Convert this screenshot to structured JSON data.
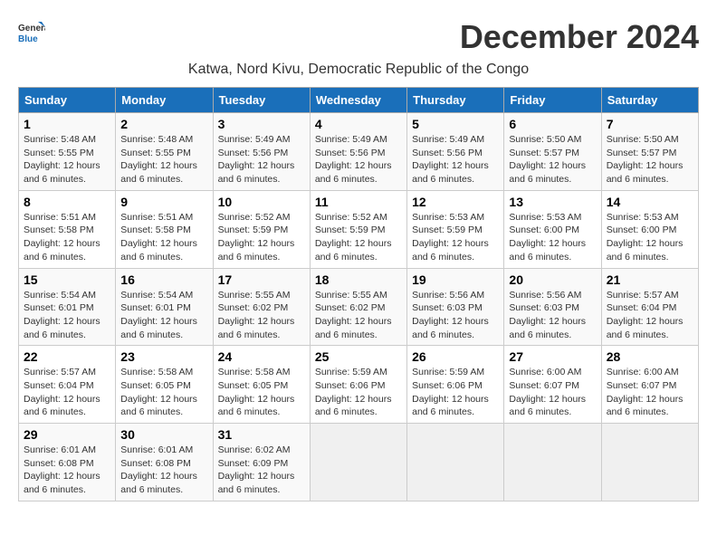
{
  "logo": {
    "line1": "General",
    "line2": "Blue"
  },
  "title": "December 2024",
  "location": "Katwa, Nord Kivu, Democratic Republic of the Congo",
  "days_of_week": [
    "Sunday",
    "Monday",
    "Tuesday",
    "Wednesday",
    "Thursday",
    "Friday",
    "Saturday"
  ],
  "weeks": [
    [
      {
        "day": "1",
        "sunrise": "Sunrise: 5:48 AM",
        "sunset": "Sunset: 5:55 PM",
        "daylight": "Daylight: 12 hours and 6 minutes."
      },
      {
        "day": "2",
        "sunrise": "Sunrise: 5:48 AM",
        "sunset": "Sunset: 5:55 PM",
        "daylight": "Daylight: 12 hours and 6 minutes."
      },
      {
        "day": "3",
        "sunrise": "Sunrise: 5:49 AM",
        "sunset": "Sunset: 5:56 PM",
        "daylight": "Daylight: 12 hours and 6 minutes."
      },
      {
        "day": "4",
        "sunrise": "Sunrise: 5:49 AM",
        "sunset": "Sunset: 5:56 PM",
        "daylight": "Daylight: 12 hours and 6 minutes."
      },
      {
        "day": "5",
        "sunrise": "Sunrise: 5:49 AM",
        "sunset": "Sunset: 5:56 PM",
        "daylight": "Daylight: 12 hours and 6 minutes."
      },
      {
        "day": "6",
        "sunrise": "Sunrise: 5:50 AM",
        "sunset": "Sunset: 5:57 PM",
        "daylight": "Daylight: 12 hours and 6 minutes."
      },
      {
        "day": "7",
        "sunrise": "Sunrise: 5:50 AM",
        "sunset": "Sunset: 5:57 PM",
        "daylight": "Daylight: 12 hours and 6 minutes."
      }
    ],
    [
      {
        "day": "8",
        "sunrise": "Sunrise: 5:51 AM",
        "sunset": "Sunset: 5:58 PM",
        "daylight": "Daylight: 12 hours and 6 minutes."
      },
      {
        "day": "9",
        "sunrise": "Sunrise: 5:51 AM",
        "sunset": "Sunset: 5:58 PM",
        "daylight": "Daylight: 12 hours and 6 minutes."
      },
      {
        "day": "10",
        "sunrise": "Sunrise: 5:52 AM",
        "sunset": "Sunset: 5:59 PM",
        "daylight": "Daylight: 12 hours and 6 minutes."
      },
      {
        "day": "11",
        "sunrise": "Sunrise: 5:52 AM",
        "sunset": "Sunset: 5:59 PM",
        "daylight": "Daylight: 12 hours and 6 minutes."
      },
      {
        "day": "12",
        "sunrise": "Sunrise: 5:53 AM",
        "sunset": "Sunset: 5:59 PM",
        "daylight": "Daylight: 12 hours and 6 minutes."
      },
      {
        "day": "13",
        "sunrise": "Sunrise: 5:53 AM",
        "sunset": "Sunset: 6:00 PM",
        "daylight": "Daylight: 12 hours and 6 minutes."
      },
      {
        "day": "14",
        "sunrise": "Sunrise: 5:53 AM",
        "sunset": "Sunset: 6:00 PM",
        "daylight": "Daylight: 12 hours and 6 minutes."
      }
    ],
    [
      {
        "day": "15",
        "sunrise": "Sunrise: 5:54 AM",
        "sunset": "Sunset: 6:01 PM",
        "daylight": "Daylight: 12 hours and 6 minutes."
      },
      {
        "day": "16",
        "sunrise": "Sunrise: 5:54 AM",
        "sunset": "Sunset: 6:01 PM",
        "daylight": "Daylight: 12 hours and 6 minutes."
      },
      {
        "day": "17",
        "sunrise": "Sunrise: 5:55 AM",
        "sunset": "Sunset: 6:02 PM",
        "daylight": "Daylight: 12 hours and 6 minutes."
      },
      {
        "day": "18",
        "sunrise": "Sunrise: 5:55 AM",
        "sunset": "Sunset: 6:02 PM",
        "daylight": "Daylight: 12 hours and 6 minutes."
      },
      {
        "day": "19",
        "sunrise": "Sunrise: 5:56 AM",
        "sunset": "Sunset: 6:03 PM",
        "daylight": "Daylight: 12 hours and 6 minutes."
      },
      {
        "day": "20",
        "sunrise": "Sunrise: 5:56 AM",
        "sunset": "Sunset: 6:03 PM",
        "daylight": "Daylight: 12 hours and 6 minutes."
      },
      {
        "day": "21",
        "sunrise": "Sunrise: 5:57 AM",
        "sunset": "Sunset: 6:04 PM",
        "daylight": "Daylight: 12 hours and 6 minutes."
      }
    ],
    [
      {
        "day": "22",
        "sunrise": "Sunrise: 5:57 AM",
        "sunset": "Sunset: 6:04 PM",
        "daylight": "Daylight: 12 hours and 6 minutes."
      },
      {
        "day": "23",
        "sunrise": "Sunrise: 5:58 AM",
        "sunset": "Sunset: 6:05 PM",
        "daylight": "Daylight: 12 hours and 6 minutes."
      },
      {
        "day": "24",
        "sunrise": "Sunrise: 5:58 AM",
        "sunset": "Sunset: 6:05 PM",
        "daylight": "Daylight: 12 hours and 6 minutes."
      },
      {
        "day": "25",
        "sunrise": "Sunrise: 5:59 AM",
        "sunset": "Sunset: 6:06 PM",
        "daylight": "Daylight: 12 hours and 6 minutes."
      },
      {
        "day": "26",
        "sunrise": "Sunrise: 5:59 AM",
        "sunset": "Sunset: 6:06 PM",
        "daylight": "Daylight: 12 hours and 6 minutes."
      },
      {
        "day": "27",
        "sunrise": "Sunrise: 6:00 AM",
        "sunset": "Sunset: 6:07 PM",
        "daylight": "Daylight: 12 hours and 6 minutes."
      },
      {
        "day": "28",
        "sunrise": "Sunrise: 6:00 AM",
        "sunset": "Sunset: 6:07 PM",
        "daylight": "Daylight: 12 hours and 6 minutes."
      }
    ],
    [
      {
        "day": "29",
        "sunrise": "Sunrise: 6:01 AM",
        "sunset": "Sunset: 6:08 PM",
        "daylight": "Daylight: 12 hours and 6 minutes."
      },
      {
        "day": "30",
        "sunrise": "Sunrise: 6:01 AM",
        "sunset": "Sunset: 6:08 PM",
        "daylight": "Daylight: 12 hours and 6 minutes."
      },
      {
        "day": "31",
        "sunrise": "Sunrise: 6:02 AM",
        "sunset": "Sunset: 6:09 PM",
        "daylight": "Daylight: 12 hours and 6 minutes."
      },
      null,
      null,
      null,
      null
    ]
  ]
}
